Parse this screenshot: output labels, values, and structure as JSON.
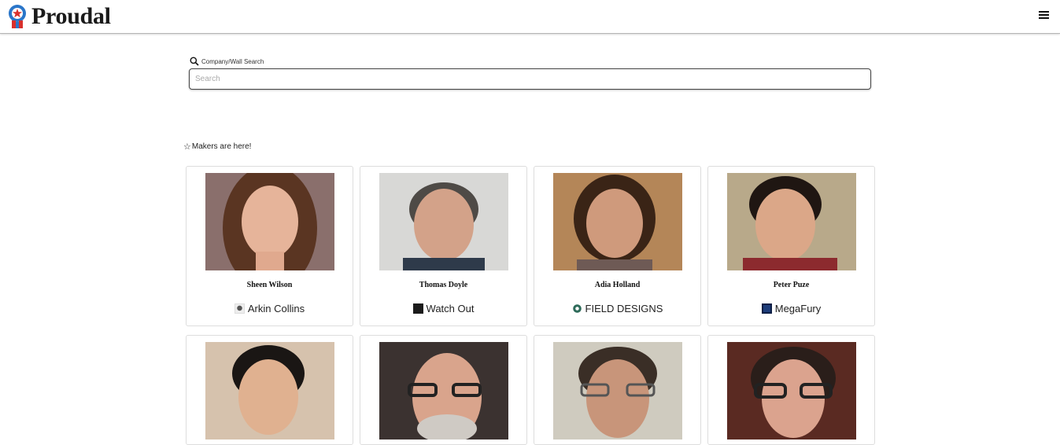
{
  "header": {
    "logo_text": "Proudal",
    "menu_icon": "hamburger-menu-icon"
  },
  "search": {
    "label": "Company/Wall Search",
    "placeholder": "Search",
    "value": ""
  },
  "makers": {
    "title": "Makers are here!",
    "cards": [
      {
        "name": "Sheen Wilson",
        "company": "Arkin Collins"
      },
      {
        "name": "Thomas Doyle",
        "company": "Watch Out"
      },
      {
        "name": "Adia Holland",
        "company": "FIELD DESIGNS"
      },
      {
        "name": "Peter Puze",
        "company": "MegaFury"
      },
      {
        "name": "",
        "company": ""
      },
      {
        "name": "",
        "company": ""
      },
      {
        "name": "",
        "company": ""
      },
      {
        "name": "",
        "company": ""
      }
    ]
  },
  "colors": {
    "logo_red": "#d9302c",
    "logo_blue": "#2a76c9",
    "border": "#dddddd"
  }
}
